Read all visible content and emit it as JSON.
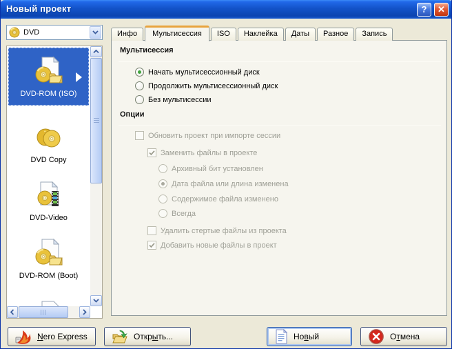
{
  "window": {
    "title": "Новый проект"
  },
  "titlebar": {
    "help_glyph": "?",
    "close_glyph": "✕"
  },
  "profile_combo": {
    "value": "DVD"
  },
  "project_list": {
    "items": [
      {
        "label": "DVD-ROM (ISO)",
        "selected": true
      },
      {
        "label": "DVD Copy",
        "selected": false
      },
      {
        "label": "DVD-Video",
        "selected": false
      },
      {
        "label": "DVD-ROM (Boot)",
        "selected": false
      }
    ]
  },
  "tabs": [
    {
      "label": "Инфо",
      "active": false
    },
    {
      "label": "Мультисессия",
      "active": true
    },
    {
      "label": "ISO",
      "active": false
    },
    {
      "label": "Наклейка",
      "active": false
    },
    {
      "label": "Даты",
      "active": false
    },
    {
      "label": "Разное",
      "active": false
    },
    {
      "label": "Запись",
      "active": false
    }
  ],
  "multisession": {
    "group_title": "Мультисессия",
    "radio_start": "Начать мультисессионный диск",
    "radio_continue": "Продолжить мультисессионный диск",
    "radio_none": "Без мультисессии",
    "selected": "Начать мультисессионный диск"
  },
  "options": {
    "group_title": "Опции",
    "update_project": "Обновить проект при импорте сессии",
    "replace_files": "Заменить файлы в проекте",
    "archive_bit": "Архивный бит установлен",
    "date_or_length": "Дата файла или длина изменена",
    "content_changed": "Содержимое файла изменено",
    "always": "Всегда",
    "remove_deleted": "Удалить стертые файлы из проекта",
    "add_new": "Добавить новые файлы в проект",
    "checked_items": [
      "Заменить файлы в проекте",
      "Дата файла или длина изменена",
      "Добавить новые файлы в проект"
    ],
    "all_disabled": true
  },
  "footer": {
    "nero_express": {
      "pre": "",
      "accel": "N",
      "rest": "ero Express"
    },
    "open": {
      "pre": "Откр",
      "accel": "ы",
      "rest": "ть..."
    },
    "new": {
      "pre": "Но",
      "accel": "в",
      "rest": "ый"
    },
    "cancel": {
      "pre": "О",
      "accel": "т",
      "rest": "мена"
    }
  },
  "colors": {
    "titlebar_blue": "#1353C9",
    "dialog_bg": "#ECE9D8",
    "panel_bg": "#F6F5EE",
    "selection_blue": "#2F63C6",
    "active_tab_accent": "#E8A33D",
    "radio_green": "#3FA43C",
    "disabled_text": "#9FA097",
    "cancel_red": "#D5281E",
    "disc_gold": "#E9C23B"
  },
  "icons": [
    "dvd-disc-icon",
    "dvd-iso-icon",
    "dvd-copy-icon",
    "dvd-video-icon",
    "dvd-boot-icon",
    "document-icon",
    "nero-flame-icon",
    "open-folder-icon",
    "new-document-icon",
    "cancel-icon",
    "help-icon",
    "close-icon",
    "chevron-down-icon",
    "scroll-arrow-icons",
    "selected-item-arrow-icon"
  ]
}
